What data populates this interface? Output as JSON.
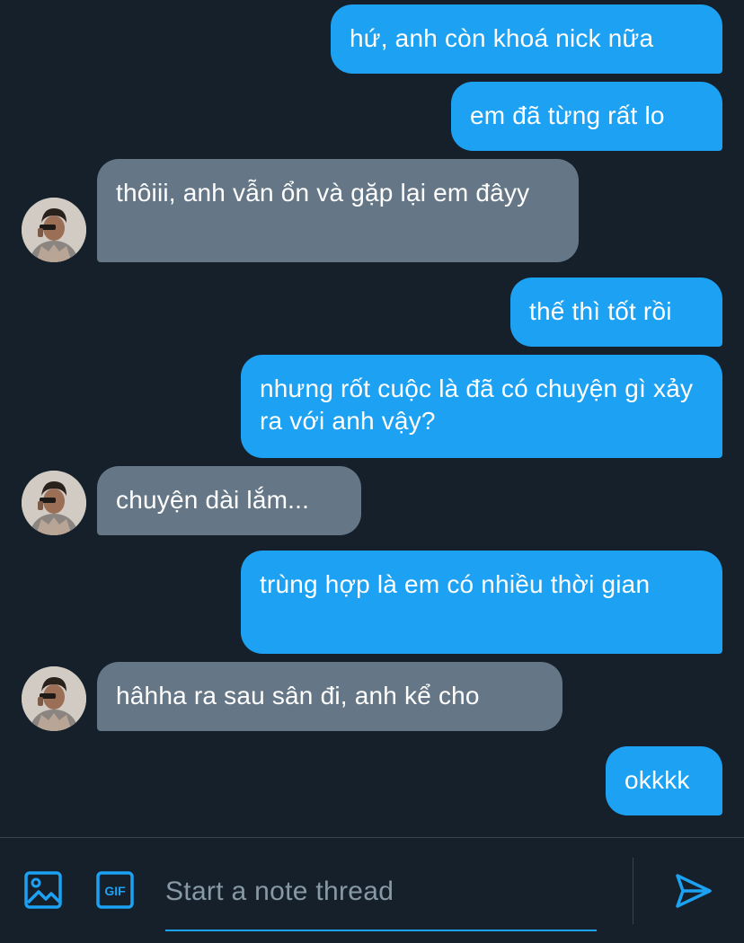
{
  "conversation": {
    "messages": [
      {
        "direction": "sent",
        "text": "hứ, anh còn khoá nick nữa"
      },
      {
        "direction": "sent",
        "text": "em đã từng rất lo"
      },
      {
        "direction": "received",
        "text": "thôiii, anh vẫn ổn và gặp lại em đâyy"
      },
      {
        "direction": "sent",
        "text": "thế thì tốt rồi"
      },
      {
        "direction": "sent",
        "text": "nhưng rốt cuộc là đã có chuyện gì xảy ra với anh vậy?"
      },
      {
        "direction": "received",
        "text": "chuyện dài lắm..."
      },
      {
        "direction": "sent",
        "text": "trùng hợp là em có nhiều thời gian"
      },
      {
        "direction": "received",
        "text": "hâhha ra sau sân đi, anh kể cho"
      },
      {
        "direction": "sent",
        "text": "okkkk"
      }
    ]
  },
  "composer": {
    "placeholder": "Start a note thread",
    "value": "",
    "gif_label": "GIF",
    "icons": {
      "media": "image-icon",
      "gif": "gif-icon",
      "send": "send-icon"
    }
  },
  "colors": {
    "background": "#15202b",
    "sent_bubble": "#1da1f2",
    "received_bubble": "#657786",
    "accent": "#1da1f2",
    "placeholder": "#8899a6",
    "divider": "#38444d"
  }
}
